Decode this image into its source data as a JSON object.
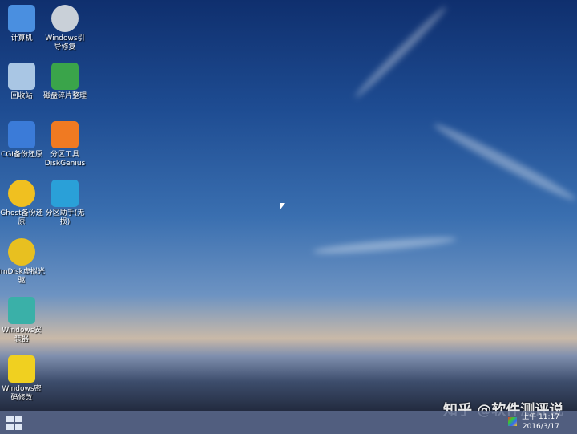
{
  "desktop_icons": [
    {
      "label": "计算机",
      "icon": "computer-icon",
      "color": "#4a8fe0"
    },
    {
      "label": "Windows引导修复",
      "icon": "gear-icon",
      "color": "#c9d0d8"
    },
    {
      "label": "回收站",
      "icon": "recycle-bin-icon",
      "color": "#a9c6e4"
    },
    {
      "label": "磁盘碎片整理",
      "icon": "defrag-icon",
      "color": "#3aa44a"
    },
    {
      "label": "CGI备份还原",
      "icon": "cgi-backup-icon",
      "color": "#3b7bd8"
    },
    {
      "label": "分区工具DiskGenius",
      "icon": "diskgenius-icon",
      "color": "#f07a22"
    },
    {
      "label": "Ghost备份还原",
      "icon": "ghost-icon",
      "color": "#f0c020"
    },
    {
      "label": "分区助手(无损)",
      "icon": "partition-assistant-icon",
      "color": "#2aa0d8"
    },
    {
      "label": "ImDisk虚拟光驱",
      "icon": "virtual-drive-icon",
      "color": "#e8c020"
    },
    {
      "label": "Windows安装器",
      "icon": "installer-icon",
      "color": "#3ab0a8"
    },
    {
      "label": "Windows密码修改",
      "icon": "key-icon",
      "color": "#f0d020"
    }
  ],
  "taskbar": {
    "time": "上午 11:17",
    "date": "2016/3/17"
  },
  "watermark": "知乎 @软件测评说"
}
